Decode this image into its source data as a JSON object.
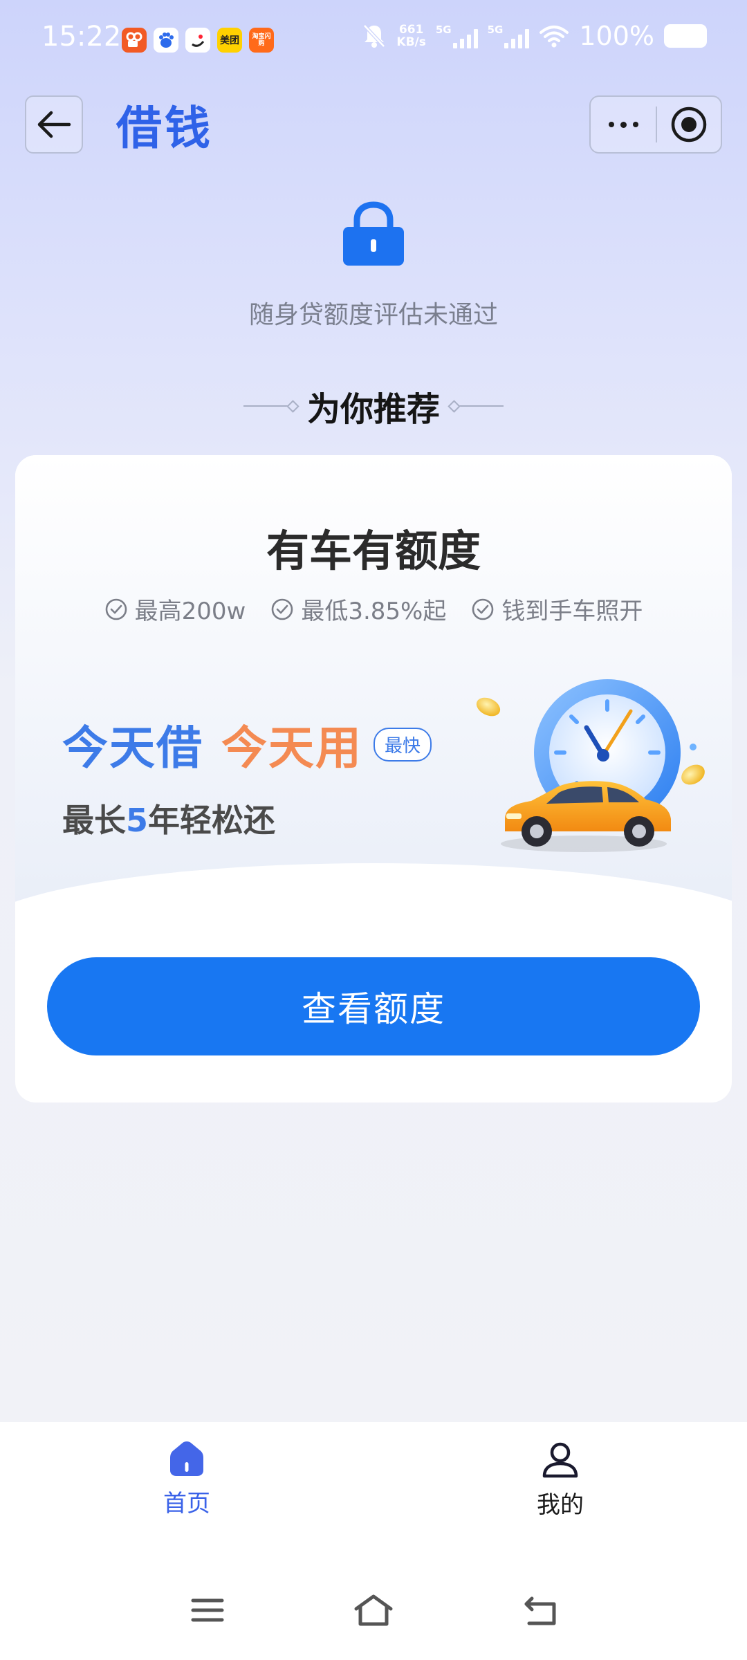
{
  "status_bar": {
    "time": "15:22",
    "app_icons": [
      "kuaishou-icon",
      "baidu-icon",
      "douyin-lite-icon",
      "meituan-icon",
      "taobao-shangou-icon"
    ],
    "meituan_text": "美团",
    "taobao_text": "淘宝闪购",
    "net_speed_value": "661",
    "net_speed_unit": "KB/s",
    "sim1_label": "5G",
    "sim2_label": "5G",
    "battery": "100%"
  },
  "header": {
    "title": "借钱"
  },
  "lock_section": {
    "status_text": "随身贷额度评估未通过"
  },
  "recommend": {
    "title": "为你推荐"
  },
  "card": {
    "heading": "有车有额度",
    "features": [
      "最高200w",
      "最低3.85%起",
      "钱到手车照开"
    ],
    "slogan_part1": "今天借",
    "slogan_part2": "今天用",
    "badge": "最快",
    "sub_prefix": "最长",
    "sub_number": "5",
    "sub_suffix": "年轻松还",
    "button": "查看额度"
  },
  "tabbar": {
    "items": [
      {
        "label": "首页",
        "icon": "home-icon",
        "active": true
      },
      {
        "label": "我的",
        "icon": "user-icon",
        "active": false
      }
    ]
  },
  "colors": {
    "accent": "#1877f2",
    "title_blue": "#2f62e8",
    "slogan_orange": "#f48a52"
  }
}
